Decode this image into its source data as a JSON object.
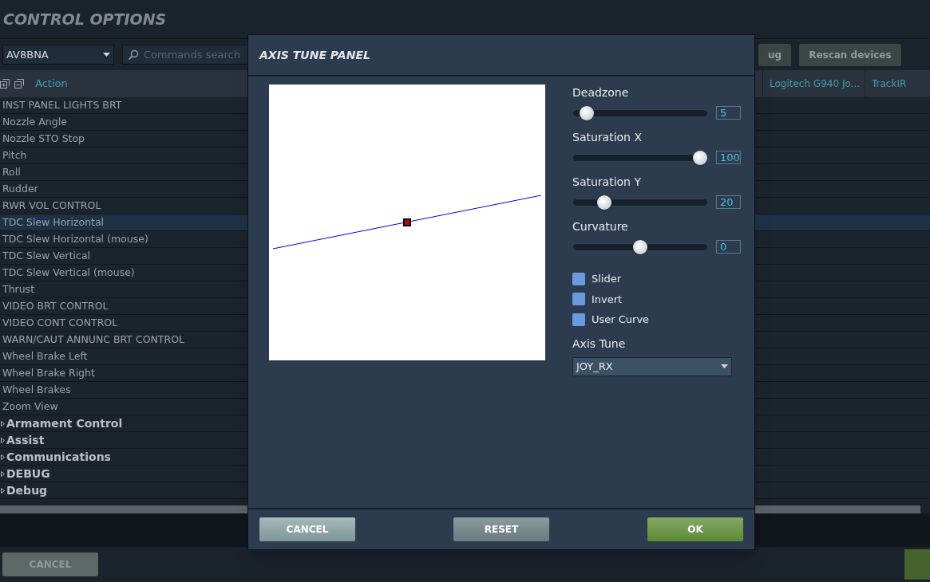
{
  "page_title": "CONTROL OPTIONS",
  "toolbar": {
    "aircraft": "AV8BNA",
    "search": {
      "placeholder": "Commands search"
    },
    "buttons": [
      "ug",
      "Rescan devices"
    ]
  },
  "table": {
    "action_header": "Action",
    "device_columns": [
      "Logitech G940 Jo...",
      "TrackIR"
    ],
    "rows": [
      {
        "kind": "command",
        "label": "INST PANEL LIGHTS BRT",
        "selected": false
      },
      {
        "kind": "command",
        "label": "Nozzle Angle",
        "selected": false
      },
      {
        "kind": "command",
        "label": "Nozzle STO Stop",
        "selected": false
      },
      {
        "kind": "command",
        "label": "Pitch",
        "selected": false
      },
      {
        "kind": "command",
        "label": "Roll",
        "selected": false
      },
      {
        "kind": "command",
        "label": "Rudder",
        "selected": false
      },
      {
        "kind": "command",
        "label": "RWR VOL CONTROL",
        "selected": false
      },
      {
        "kind": "command",
        "label": "TDC Slew Horizontal",
        "selected": true
      },
      {
        "kind": "command",
        "label": "TDC Slew Horizontal (mouse)",
        "selected": false
      },
      {
        "kind": "command",
        "label": "TDC Slew Vertical",
        "selected": false
      },
      {
        "kind": "command",
        "label": "TDC Slew Vertical (mouse)",
        "selected": false
      },
      {
        "kind": "command",
        "label": "Thrust",
        "selected": false
      },
      {
        "kind": "command",
        "label": "VIDEO BRT CONTROL",
        "selected": false
      },
      {
        "kind": "command",
        "label": "VIDEO CONT CONTROL",
        "selected": false
      },
      {
        "kind": "command",
        "label": "WARN/CAUT ANNUNC BRT CONTROL",
        "selected": false
      },
      {
        "kind": "command",
        "label": "Wheel Brake Left",
        "selected": false
      },
      {
        "kind": "command",
        "label": "Wheel Brake Right",
        "selected": false
      },
      {
        "kind": "command",
        "label": "Wheel Brakes",
        "selected": false
      },
      {
        "kind": "command",
        "label": "Zoom View",
        "selected": false
      },
      {
        "kind": "group",
        "label": "Armament Control",
        "selected": false,
        "expanded": false
      },
      {
        "kind": "group",
        "label": "Assist",
        "selected": false,
        "expanded": false
      },
      {
        "kind": "group",
        "label": "Communications",
        "selected": false,
        "expanded": false
      },
      {
        "kind": "group",
        "label": "DEBUG",
        "selected": false,
        "expanded": false
      },
      {
        "kind": "group",
        "label": "Debug",
        "selected": false,
        "expanded": false
      }
    ]
  },
  "footer": {
    "cancel": "CANCEL"
  },
  "dialog": {
    "title": "AXIS TUNE PANEL",
    "sliders": [
      {
        "label": "Deadzone",
        "level": 0.05,
        "value": "5"
      },
      {
        "label": "Saturation X",
        "level": 1,
        "value": "100"
      },
      {
        "label": "Saturation Y",
        "level": 0.2,
        "value": "20"
      },
      {
        "label": "Curvature",
        "level": 0.5,
        "value": "0"
      }
    ],
    "options": [
      {
        "label": "Slider",
        "checked": false
      },
      {
        "label": "Invert",
        "checked": false
      },
      {
        "label": "User Curve",
        "checked": false
      }
    ],
    "axis_tune": {
      "label": "Axis Tune",
      "value": "JOY_RX"
    },
    "buttons": [
      {
        "kind": "cancel",
        "label": "CANCEL"
      },
      {
        "kind": "reset",
        "label": "RESET"
      },
      {
        "kind": "ok",
        "label": "OK"
      }
    ]
  }
}
